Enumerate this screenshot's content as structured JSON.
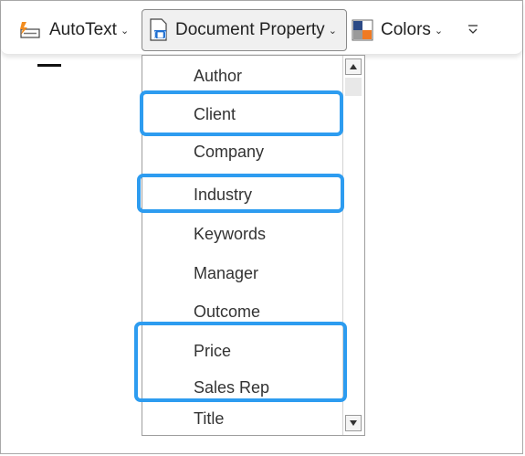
{
  "toolbar": {
    "autotext_label": "AutoText",
    "docprop_label": "Document Property",
    "colors_label": "Colors"
  },
  "dropdown": {
    "items": [
      "Author",
      "Client",
      "Company",
      "Industry",
      "Keywords",
      "Manager",
      "Outcome",
      "Price",
      "Sales Rep",
      "Title"
    ]
  },
  "colors": {
    "highlight": "#2d9cf0",
    "autotext_icon": "#f28c1e",
    "docprop_icon": "#1f6fd1",
    "colors_icon_top": "#2b4a86",
    "colors_icon_orange": "#f07a22",
    "colors_icon_gray": "#9a9a9a"
  }
}
